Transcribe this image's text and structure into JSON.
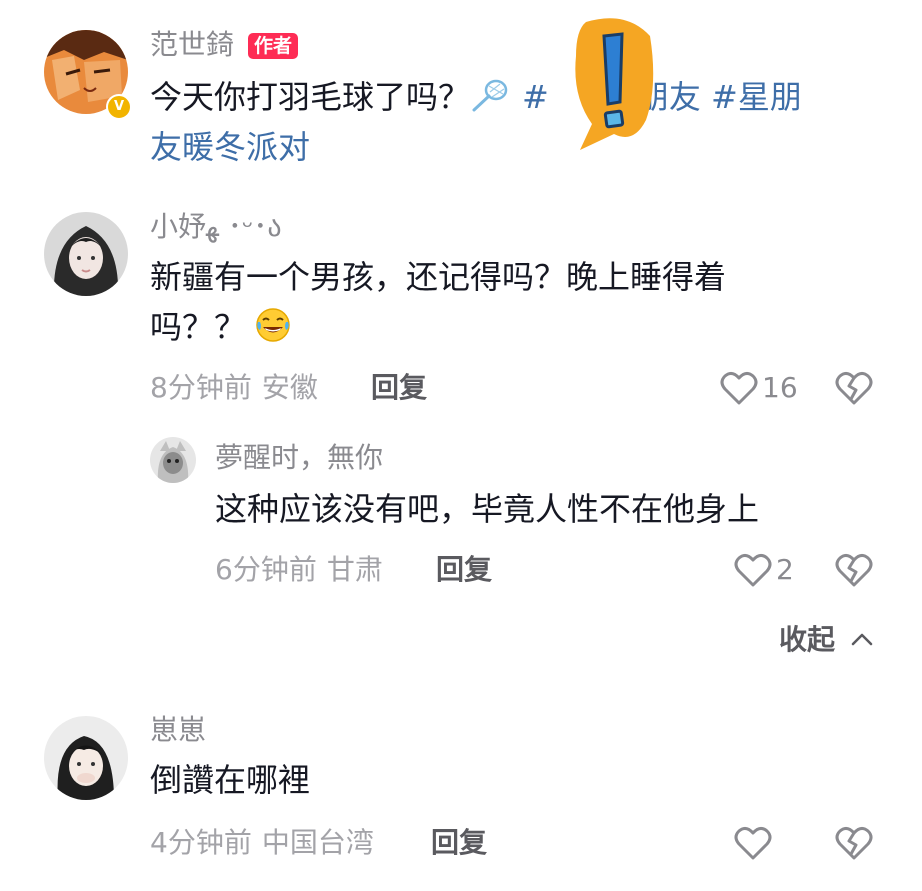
{
  "comments": [
    {
      "username": "范世錡",
      "badge": "作者",
      "text_line1_prefix": "今天你打羽毛球了吗？",
      "text_line1_tag_start": "#",
      "text_line1_tag_mid": "星朋友 #星朋",
      "text_line2": "友暖冬派对",
      "avatar_icon": "anime-character-avatar",
      "verified_icon": "verified-badge-icon",
      "inline_icon": "badminton-racket-icon"
    },
    {
      "username": "小妤ﻬ ･ᵕ･ა",
      "text_line1": "新疆有一个男孩，还记得吗？晚上睡得着",
      "text_line2": "吗？？",
      "time": "8分钟前",
      "location": "安徽",
      "reply_label": "回复",
      "likes": "16",
      "inline_icon": "laughing-tears-emoji"
    },
    {
      "username": "夢醒时，無你",
      "text_line1": "这种应该没有吧，毕竟人性不在他身上",
      "time": "6分钟前",
      "location": "甘肃",
      "reply_label": "回复",
      "likes": "2"
    },
    {
      "username": "崽崽",
      "text_line1": "倒讚在哪裡",
      "time": "4分钟前",
      "location": "中国台湾",
      "reply_label": "回复",
      "likes": ""
    }
  ],
  "collapse_label": "收起",
  "colors": {
    "badge": "#fe2c55",
    "hashtag": "#3e6ea8",
    "verified": "#f2b400",
    "sticker": "#f5a623"
  }
}
